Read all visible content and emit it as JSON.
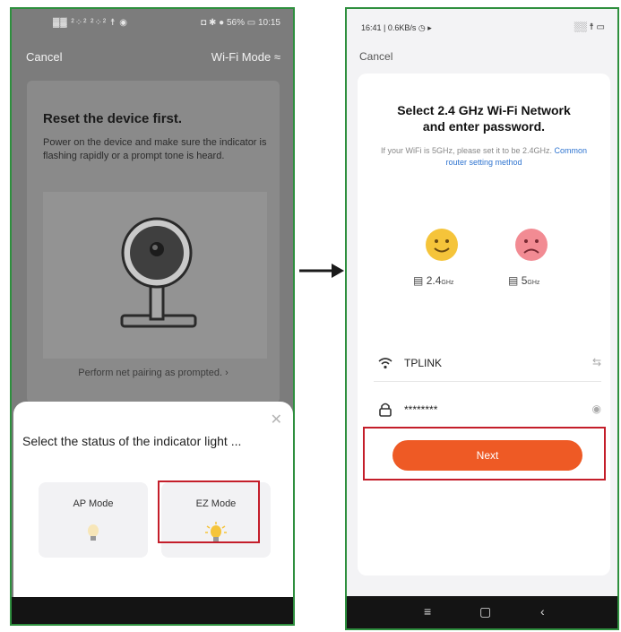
{
  "left_screen": {
    "status_left": "▓▓ ²⁘² ²⁘² ☨ ◉",
    "status_right": "◘ ✱ ● 56% ▭ 10:15",
    "cancel": "Cancel",
    "wifi_mode": "Wi-Fi Mode ≈",
    "reset_title": "Reset the device first.",
    "reset_desc": "Power on the device and make sure the indicator is flashing rapidly or a prompt tone is heard.",
    "prompt_link": "Perform net pairing as prompted. ›",
    "sheet_close": "✕",
    "sheet_question": "Select the status of the indicator light ...",
    "modes": [
      {
        "label": "AP Mode",
        "icon": "bulb-dim-icon"
      },
      {
        "label": "EZ Mode",
        "icon": "bulb-flashing-icon"
      }
    ]
  },
  "right_screen": {
    "status_left": "16:41 | 0.6KB/s ◷ ▸",
    "status_right": "░░ ☨ ▭",
    "cancel": "Cancel",
    "title_line1": "Select 2.4 GHz Wi-Fi Network",
    "title_line2": "and enter password.",
    "hint_text": "If your WiFi is 5GHz, please set it to be 2.4GHz.",
    "hint_link": "Common router setting method",
    "band_24": "2.4",
    "band_24_unit": "GHz",
    "band_5": "5",
    "band_5_unit": "GHz",
    "ssid": "TPLINK",
    "password": "********",
    "next": "Next",
    "nav": [
      "≡",
      "▢",
      "‹"
    ]
  },
  "colors": {
    "accent": "#ee5a25",
    "highlight": "#c41e2a",
    "link": "#2f74d0",
    "happy": "#f5c43a",
    "sad": "#f28b93"
  }
}
